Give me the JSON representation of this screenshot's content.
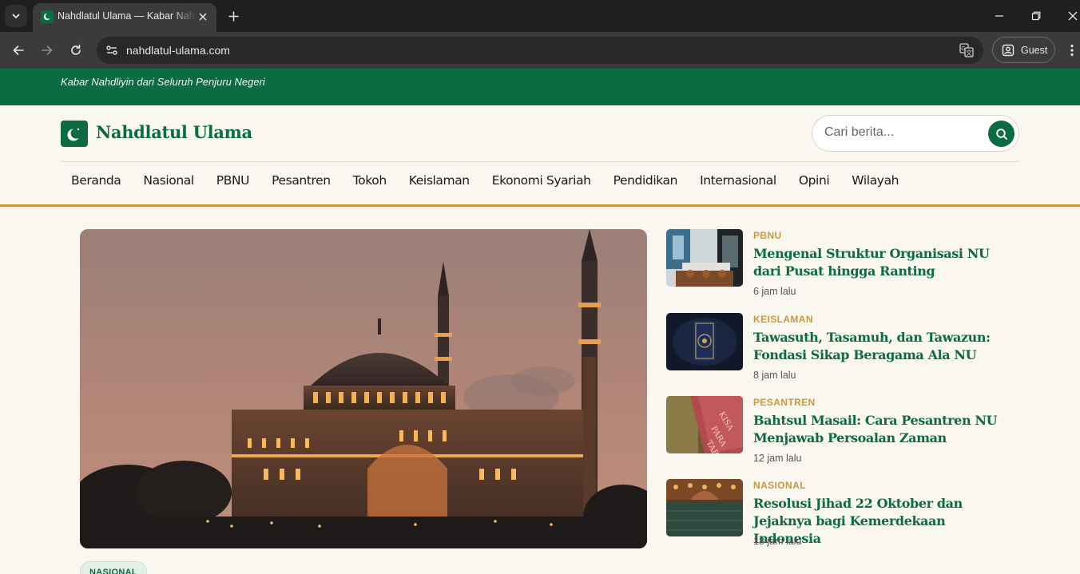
{
  "browser": {
    "tab_title": "Nahdlatul Ulama — Kabar Nahdliyin",
    "url": "nahdlatul-ulama.com",
    "profile_label": "Guest"
  },
  "site": {
    "tagline": "Kabar Nahdliyin dari Seluruh Penjuru Negeri",
    "logo_text": "Nahdlatul Ulama",
    "search_placeholder": "Cari berita...",
    "nav": [
      "Beranda",
      "Nasional",
      "PBNU",
      "Pesantren",
      "Tokoh",
      "Keislaman",
      "Ekonomi Syariah",
      "Pendidikan",
      "Internasional",
      "Opini",
      "Wilayah"
    ]
  },
  "hero": {
    "image": "mosque-at-dusk-photo",
    "category": "NASIONAL"
  },
  "side_articles": [
    {
      "category": "PBNU",
      "title": "Mengenal Struktur Organisasi NU dari Pusat hingga Ranting",
      "time": "6 jam lalu",
      "thumb": "meeting-room-photo"
    },
    {
      "category": "KEISLAMAN",
      "title": "Tawasuth, Tasamuh, dan Tawazun: Fondasi Sikap Beragama Ala NU",
      "time": "8 jam lalu",
      "thumb": "quran-book-photo"
    },
    {
      "category": "PESANTREN",
      "title": "Bahtsul Masail: Cara Pesantren NU Menjawab Persoalan Zaman",
      "time": "12 jam lalu",
      "thumb": "red-book-photo"
    },
    {
      "category": "NASIONAL",
      "title": "Resolusi Jihad 22 Oktober dan Jejaknya bagi Kemerdekaan Indonesia",
      "time": "18 jam lalu",
      "thumb": "mosque-interior-photo"
    }
  ],
  "colors": {
    "brand_green": "#0b6b42",
    "accent_gold": "#c99a3f",
    "page_background": "#faf7f0"
  }
}
